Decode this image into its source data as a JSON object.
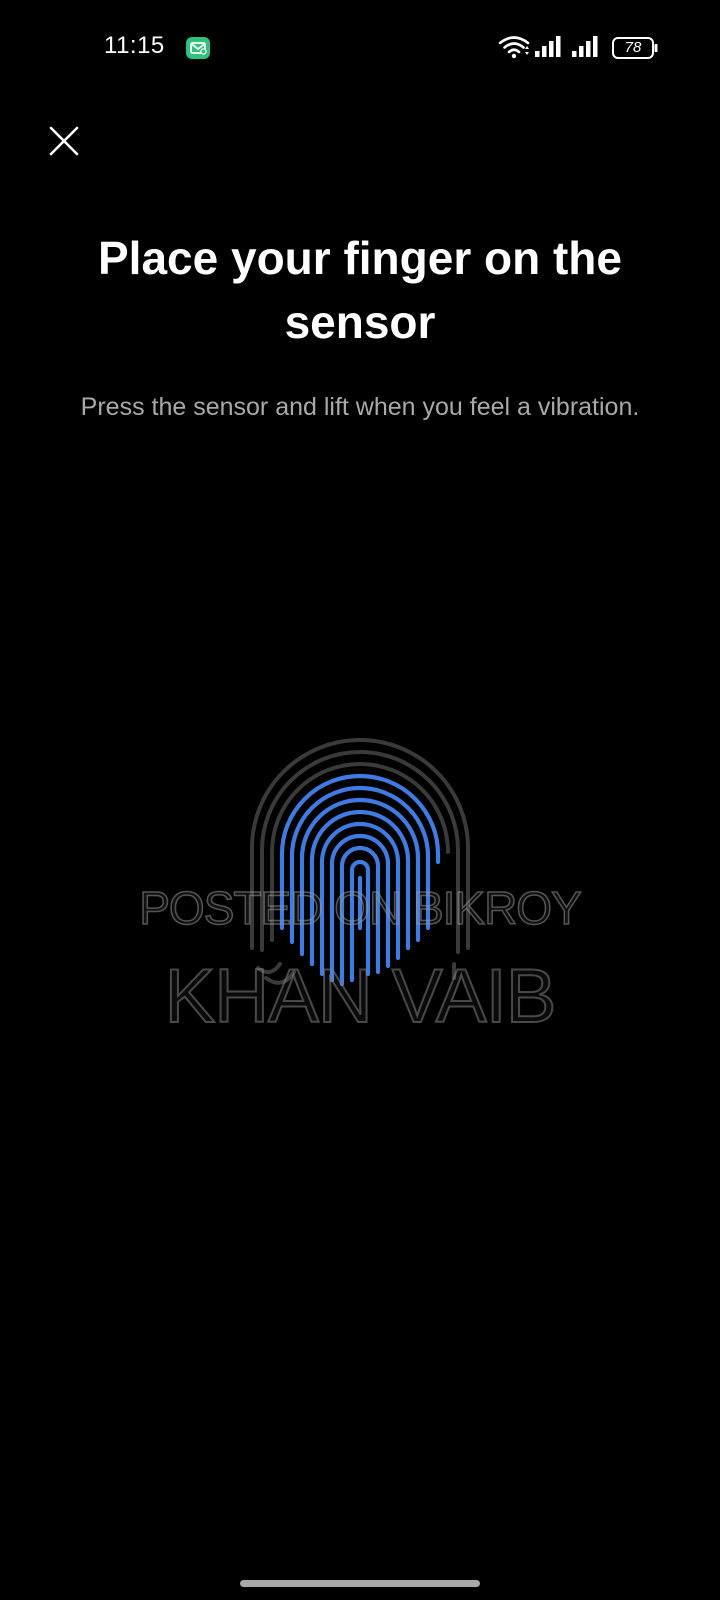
{
  "status_bar": {
    "time": "11:15",
    "battery_level": "78",
    "icons": [
      "mail-notification-icon",
      "wifi-icon",
      "signal-icon",
      "signal-icon",
      "battery-icon"
    ]
  },
  "header": {
    "close_icon": "close-icon"
  },
  "main": {
    "title": "Place your finger on the sensor",
    "subtitle": "Press the sensor and lift when you feel a vibration.",
    "fingerprint_icon": "fingerprint-icon"
  },
  "watermark": {
    "line1": "POSTED ON BIKROY",
    "line2": "KHAN VAIB"
  },
  "colors": {
    "background": "#000000",
    "title": "#ffffff",
    "subtitle": "#a9a9a9",
    "fingerprint_active": "#3f7be0",
    "fingerprint_inactive": "#3a3a3a",
    "mail_badge": "#2fc27a"
  }
}
